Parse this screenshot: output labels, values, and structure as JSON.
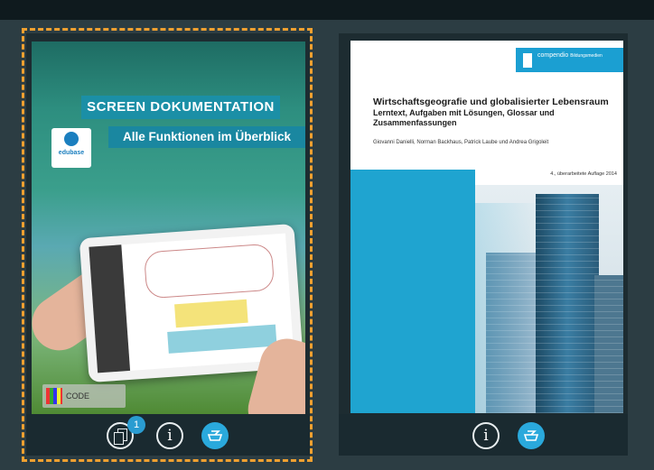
{
  "books": [
    {
      "cover": {
        "title": "SCREEN DOKUMENTATION",
        "subtitle": "Alle Funktionen im Überblick",
        "logo_text": "edubase",
        "code_label": "CODE"
      },
      "toolbar": {
        "copies_badge": "1",
        "info_label": "i"
      },
      "selected": true
    },
    {
      "cover": {
        "publisher": "compendio",
        "publisher_sub": "Bildungsmedien",
        "title": "Wirtschaftsgeografie und globalisierter Lebensraum",
        "subtitle": "Lerntext, Aufgaben mit Lösungen, Glossar und Zusammenfassungen",
        "authors": "Giovanni Danielli, Norman Backhaus, Patrick Laube und Andrea Grigoleit",
        "edition": "4., überarbeitete Auflage 2014"
      },
      "toolbar": {
        "info_label": "i"
      },
      "selected": false
    }
  ],
  "colors": {
    "selection_border": "#f0a030",
    "accent": "#2aa9dc",
    "background": "#2c3d43"
  },
  "icons": [
    "copies-icon",
    "info-icon",
    "download-icon"
  ]
}
